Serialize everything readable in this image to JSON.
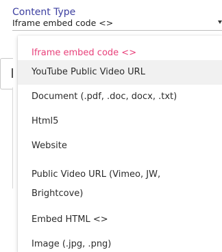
{
  "field": {
    "label": "Content Type",
    "value": "Iframe embed code <>"
  },
  "dropdown": {
    "options": [
      {
        "label": "Iframe embed code <>",
        "state": "selected"
      },
      {
        "label": "YouTube Public Video URL",
        "state": "hovered"
      },
      {
        "label": "Document (.pdf, .doc, docx, .txt)",
        "state": "normal"
      },
      {
        "label": "Html5",
        "state": "normal"
      },
      {
        "label": "Website",
        "state": "normal"
      },
      {
        "label": "Public Video URL (Vimeo, JW, Brightcove)",
        "state": "normal"
      },
      {
        "label": "Embed HTML <>",
        "state": "normal"
      },
      {
        "label": "Image (.jpg, .png)",
        "state": "normal"
      }
    ]
  },
  "colors": {
    "label": "#3c3fa0",
    "selected_option": "#e8407a",
    "hover_background": "#f1f1f1",
    "option_text": "#2b2b2b"
  }
}
